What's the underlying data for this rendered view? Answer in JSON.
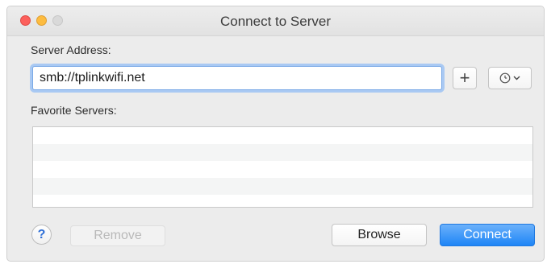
{
  "window": {
    "title": "Connect to Server"
  },
  "server_address": {
    "label": "Server Address:",
    "value": "smb://tplinkwifi.net"
  },
  "toolbar": {
    "add_label": "+",
    "recent_icon": "clock-icon",
    "chevron": "⌄"
  },
  "favorites": {
    "label": "Favorite Servers:",
    "items": []
  },
  "buttons": {
    "help": "?",
    "remove": "Remove",
    "browse": "Browse",
    "connect": "Connect"
  },
  "colors": {
    "close": "#fc605c",
    "minimize": "#fdbc40",
    "zoom": "#d9d9d9",
    "accent": "#1e85f6"
  }
}
